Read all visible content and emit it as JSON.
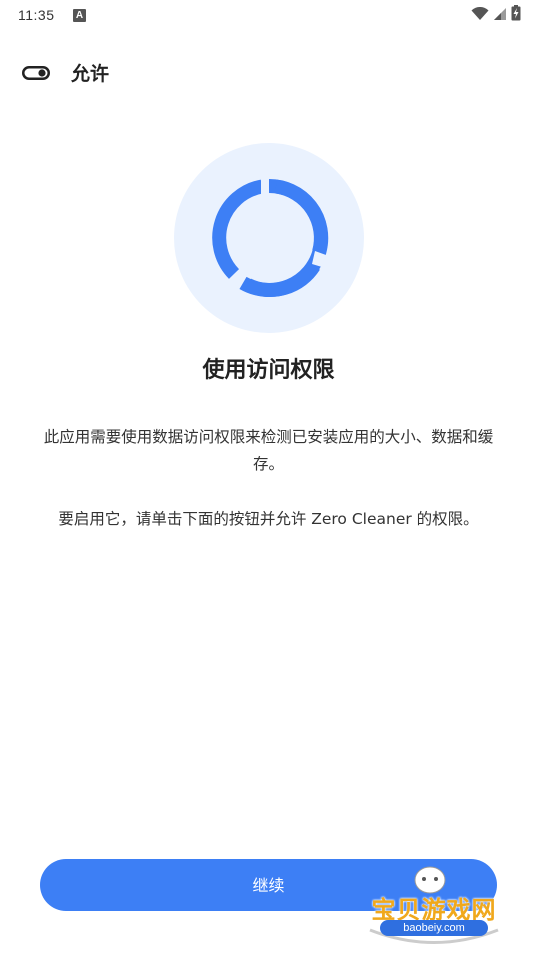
{
  "status_bar": {
    "time": "11:35",
    "notification_icon": "A",
    "icons": [
      "wifi-icon",
      "signal-icon",
      "battery-charging-icon"
    ]
  },
  "top_bar": {
    "icon": "toggle-icon",
    "title": "允许"
  },
  "main": {
    "illustration_icon": "storage-ring-icon",
    "heading": "使用访问权限",
    "description_1": "此应用需要使用数据访问权限来检测已安装应用的大小、数据和缓存。",
    "description_2": "要启用它，请单击下面的按钮并允许 Zero Cleaner 的权限。"
  },
  "continue_button": {
    "label": "继续"
  },
  "watermark": {
    "text": "宝贝游戏网",
    "url": "baobeiy.com"
  },
  "colors": {
    "accent": "#3d7ff5",
    "illustration_bg": "#eaf2fe",
    "text_primary": "#222222",
    "text_secondary": "#333333",
    "watermark": "#f0a81c"
  }
}
